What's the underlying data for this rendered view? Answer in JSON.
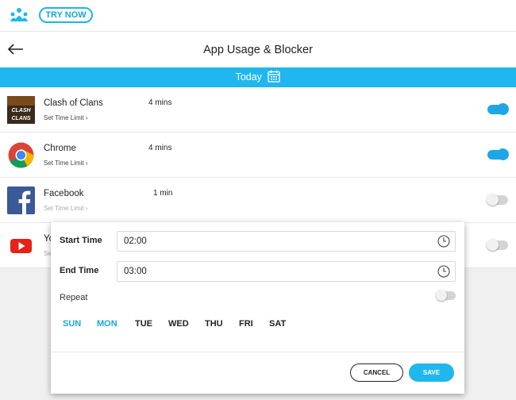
{
  "topbar": {
    "logo_icon": "family-logo-icon",
    "try_now_label": "TRY NOW",
    "accent": "#1fb7ee"
  },
  "header": {
    "back_icon": "arrow-left-icon",
    "title": "App Usage & Blocker"
  },
  "date_bar": {
    "label": "Today",
    "icon": "calendar-icon"
  },
  "apps": [
    {
      "name": "Clash of Clans",
      "usage": "4 mins",
      "limit_label": "Set Time Limit ›",
      "enabled": true,
      "icon": "clash-of-clans-icon"
    },
    {
      "name": "Chrome",
      "usage": "4 mins",
      "limit_label": "Set Time Limit ›",
      "enabled": true,
      "icon": "chrome-icon"
    },
    {
      "name": "Facebook",
      "usage": "1 min",
      "limit_label": "Set Time Limit ›",
      "enabled": false,
      "icon": "facebook-icon"
    },
    {
      "name": "Yo",
      "limit_label": "Se",
      "enabled": false,
      "icon": "youtube-icon"
    }
  ],
  "clash_logo_text": "CLASH of CLANS",
  "modal": {
    "start_label": "Start Time",
    "start_value": "02:00",
    "end_label": "End Time",
    "end_value": "03:00",
    "repeat_label": "Repeat",
    "repeat_enabled": false,
    "days": [
      {
        "label": "SUN",
        "active": true
      },
      {
        "label": "MON",
        "active": true
      },
      {
        "label": "TUE",
        "active": false
      },
      {
        "label": "WED",
        "active": false
      },
      {
        "label": "THU",
        "active": false
      },
      {
        "label": "FRI",
        "active": false
      },
      {
        "label": "SAT",
        "active": false
      }
    ],
    "cancel_label": "CANCEL",
    "save_label": "SAVE"
  }
}
